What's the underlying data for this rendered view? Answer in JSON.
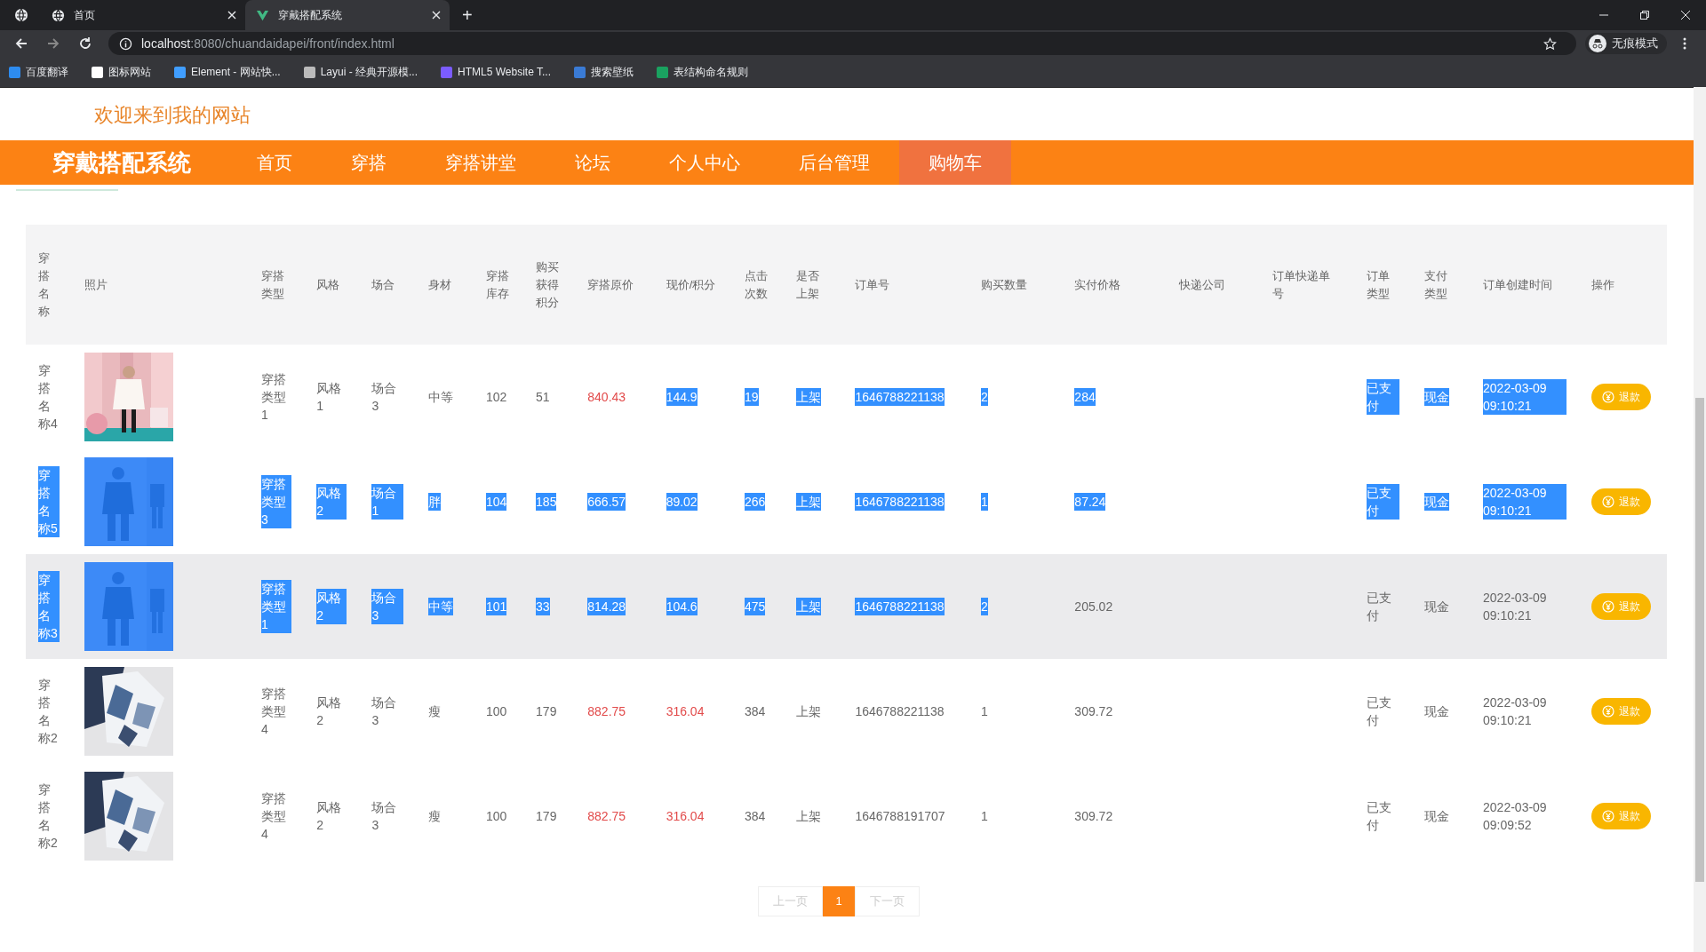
{
  "browser": {
    "tabs": [
      {
        "title": "首页",
        "selected": false
      },
      {
        "title": "穿戴搭配系统",
        "selected": true
      }
    ],
    "new_tab": "+",
    "url_host": "localhost",
    "url_rest": ":8080/chuandaidapei/front/index.html",
    "bookmarks": [
      {
        "label": "百度翻译",
        "color": "#2d8cf0"
      },
      {
        "label": "图标网站",
        "color": "#ffffff"
      },
      {
        "label": "Element - 网站快...",
        "color": "#409eff"
      },
      {
        "label": "Layui - 经典开源模...",
        "color": "#bbbbbb"
      },
      {
        "label": "HTML5 Website T...",
        "color": "#7b5cff"
      },
      {
        "label": "搜索壁纸",
        "color": "#3a7bd5"
      },
      {
        "label": "表结构命名规则",
        "color": "#1aa260"
      }
    ],
    "profile": "无痕模式"
  },
  "welcome": "欢迎来到我的网站",
  "nav": {
    "brand": "穿戴搭配系统",
    "items": [
      {
        "label": "首页",
        "selected": false
      },
      {
        "label": "穿搭",
        "selected": false
      },
      {
        "label": "穿搭讲堂",
        "selected": false
      },
      {
        "label": "论坛",
        "selected": false
      },
      {
        "label": "个人中心",
        "selected": false
      },
      {
        "label": "后台管理",
        "selected": false
      },
      {
        "label": "购物车",
        "selected": true
      }
    ]
  },
  "table": {
    "columns": [
      {
        "label": "穿搭名称",
        "kind": "text"
      },
      {
        "label": "照片"
      },
      {
        "label": "穿搭类型",
        "kind": "text"
      },
      {
        "label": "风格",
        "kind": "text"
      },
      {
        "label": "场合",
        "kind": "text"
      },
      {
        "label": "身材",
        "kind": "text"
      },
      {
        "label": "穿搭库存",
        "kind": "text"
      },
      {
        "label": "购买获得积分",
        "kind": "text"
      },
      {
        "label": "穿搭原价",
        "kind": "price"
      },
      {
        "label": "现价/积分",
        "kind": "price"
      },
      {
        "label": "点击次数",
        "kind": "text"
      },
      {
        "label": "是否上架",
        "kind": "text"
      },
      {
        "label": "订单号",
        "kind": "text"
      },
      {
        "label": "购买数量",
        "kind": "text"
      },
      {
        "label": "实付价格",
        "kind": "text"
      },
      {
        "label": "快递公司",
        "kind": "text"
      },
      {
        "label": "订单快递单号",
        "kind": "text"
      },
      {
        "label": "订单类型",
        "kind": "text"
      },
      {
        "label": "支付类型",
        "kind": "text"
      },
      {
        "label": "订单创建时间",
        "kind": "text"
      },
      {
        "label": "操作",
        "kind": "action"
      }
    ],
    "rows": [
      {
        "hovered": false,
        "cells": [
          {
            "text": "穿搭名称4",
            "selected": false
          },
          {
            "kind": "picture",
            "selected": false
          },
          {
            "text": "穿搭类型1",
            "selected": false
          },
          {
            "text": "风格1",
            "selected": false
          },
          {
            "text": "场合3",
            "selected": false
          },
          {
            "text": "中等",
            "selected": false
          },
          {
            "text": "102",
            "selected": false
          },
          {
            "text": "51",
            "selected": false
          },
          {
            "text": "840.43",
            "selected": false
          },
          {
            "text": "144.9",
            "selected": true
          },
          {
            "text": "19",
            "selected": true
          },
          {
            "text": "上架",
            "selected": true
          },
          {
            "text": "1646788221138",
            "selected": true
          },
          {
            "text": "2",
            "selected": true
          },
          {
            "text": "284",
            "selected": true
          },
          null,
          null,
          {
            "text": "已支付",
            "selected": true
          },
          {
            "text": "现金",
            "selected": true
          },
          {
            "text": "2022-03-09 09:10:21",
            "selected": true
          },
          {
            "text": "退款"
          }
        ]
      },
      {
        "hovered": false,
        "cells": [
          {
            "text": "穿搭名称5",
            "selected": true
          },
          {
            "kind": "picture",
            "selected": true
          },
          {
            "text": "穿搭类型3",
            "selected": true
          },
          {
            "text": "风格2",
            "selected": true
          },
          {
            "text": "场合1",
            "selected": true
          },
          {
            "text": "胖",
            "selected": true
          },
          {
            "text": "104",
            "selected": true
          },
          {
            "text": "185",
            "selected": true
          },
          {
            "text": "666.57",
            "selected": true
          },
          {
            "text": "89.02",
            "selected": true
          },
          {
            "text": "266",
            "selected": true
          },
          {
            "text": "上架",
            "selected": true
          },
          {
            "text": "1646788221138",
            "selected": true
          },
          {
            "text": "1",
            "selected": true
          },
          {
            "text": "87.24",
            "selected": true
          },
          null,
          null,
          {
            "text": "已支付",
            "selected": true
          },
          {
            "text": "现金",
            "selected": true
          },
          {
            "text": "2022-03-09 09:10:21",
            "selected": true
          },
          {
            "text": "退款"
          }
        ]
      },
      {
        "hovered": true,
        "cells": [
          {
            "text": "穿搭名称3",
            "selected": true
          },
          {
            "kind": "picture",
            "selected": true
          },
          {
            "text": "穿搭类型1",
            "selected": true
          },
          {
            "text": "风格2",
            "selected": true
          },
          {
            "text": "场合3",
            "selected": true
          },
          {
            "text": "中等",
            "selected": true
          },
          {
            "text": "101",
            "selected": true
          },
          {
            "text": "33",
            "selected": true
          },
          {
            "text": "814.28",
            "selected": true
          },
          {
            "text": "104.6",
            "selected": true
          },
          {
            "text": "475",
            "selected": true
          },
          {
            "text": "上架",
            "selected": true
          },
          {
            "text": "1646788221138",
            "selected": true
          },
          {
            "text": "2",
            "selected": true
          },
          {
            "text": "205.02",
            "selected": false
          },
          null,
          null,
          {
            "text": "已支付",
            "selected": false
          },
          {
            "text": "现金",
            "selected": false
          },
          {
            "text": "2022-03-09 09:10:21",
            "selected": false
          },
          {
            "text": "退款"
          }
        ]
      },
      {
        "hovered": false,
        "cells": [
          {
            "text": "穿搭名称2",
            "selected": false
          },
          {
            "kind": "picture",
            "selected": false
          },
          {
            "text": "穿搭类型4",
            "selected": false
          },
          {
            "text": "风格2",
            "selected": false
          },
          {
            "text": "场合3",
            "selected": false
          },
          {
            "text": "瘦",
            "selected": false
          },
          {
            "text": "100",
            "selected": false
          },
          {
            "text": "179",
            "selected": false
          },
          {
            "text": "882.75",
            "selected": false
          },
          {
            "text": "316.04",
            "selected": false
          },
          {
            "text": "384",
            "selected": false
          },
          {
            "text": "上架",
            "selected": false
          },
          {
            "text": "1646788221138",
            "selected": false
          },
          {
            "text": "1",
            "selected": false
          },
          {
            "text": "309.72",
            "selected": false
          },
          null,
          null,
          {
            "text": "已支付",
            "selected": false
          },
          {
            "text": "现金",
            "selected": false
          },
          {
            "text": "2022-03-09 09:10:21",
            "selected": false
          },
          {
            "text": "退款"
          }
        ]
      },
      {
        "hovered": false,
        "cells": [
          {
            "text": "穿搭名称2",
            "selected": false
          },
          {
            "kind": "picture",
            "selected": false
          },
          {
            "text": "穿搭类型4",
            "selected": false
          },
          {
            "text": "风格2",
            "selected": false
          },
          {
            "text": "场合3",
            "selected": false
          },
          {
            "text": "瘦",
            "selected": false
          },
          {
            "text": "100",
            "selected": false
          },
          {
            "text": "179",
            "selected": false
          },
          {
            "text": "882.75",
            "selected": false
          },
          {
            "text": "316.04",
            "selected": false
          },
          {
            "text": "384",
            "selected": false
          },
          {
            "text": "上架",
            "selected": false
          },
          {
            "text": "1646788191707",
            "selected": false
          },
          {
            "text": "1",
            "selected": false
          },
          {
            "text": "309.72",
            "selected": false
          },
          null,
          null,
          {
            "text": "已支付",
            "selected": false
          },
          {
            "text": "现金",
            "selected": false
          },
          {
            "text": "2022-03-09 09:09:52",
            "selected": false
          },
          {
            "text": "退款"
          }
        ]
      }
    ]
  },
  "pagination": {
    "prev": {
      "label": "上一页",
      "disabled": true
    },
    "pages": [
      {
        "label": "1",
        "selected": true
      }
    ],
    "next": {
      "label": "下一页",
      "disabled": true
    }
  }
}
